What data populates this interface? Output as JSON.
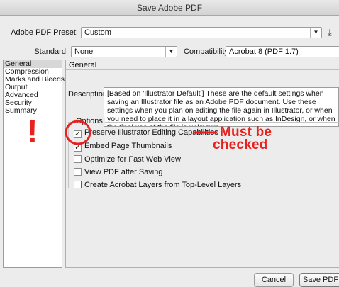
{
  "window": {
    "title": "Save Adobe PDF"
  },
  "preset": {
    "label": "Adobe PDF Preset:",
    "value": "Custom"
  },
  "standard": {
    "label": "Standard:",
    "value": "None"
  },
  "compatibility": {
    "label": "Compatibility:",
    "value": "Acrobat 8 (PDF 1.7)"
  },
  "sidebar": {
    "items": [
      {
        "label": "General",
        "active": true
      },
      {
        "label": "Compression"
      },
      {
        "label": "Marks and Bleeds"
      },
      {
        "label": "Output"
      },
      {
        "label": "Advanced"
      },
      {
        "label": "Security"
      },
      {
        "label": "Summary"
      }
    ]
  },
  "panel": {
    "header": "General",
    "description_label": "Description:",
    "description_text": "[Based on 'Illustrator Default'] These are the default settings when saving an Illustrator file as an Adobe PDF document. Use these settings when you plan on editing the file again in Illustrator, or when you need to place it in a layout application such as InDesign, or when the final use of the file is unknown.",
    "options_label": "Options",
    "options": [
      {
        "label": "Preserve Illustrator Editing Capabilities",
        "checked": true
      },
      {
        "label": "Embed Page Thumbnails",
        "checked": true
      },
      {
        "label": "Optimize for Fast Web View",
        "checked": false
      },
      {
        "label": "View PDF after Saving",
        "checked": false
      },
      {
        "label": "Create Acrobat Layers from Top-Level Layers",
        "checked": false
      }
    ]
  },
  "buttons": {
    "cancel": "Cancel",
    "save": "Save PDF"
  },
  "annotation": {
    "exclaim": "!",
    "line1": "Must be",
    "line2": "checked",
    "color": "#e8211f"
  }
}
